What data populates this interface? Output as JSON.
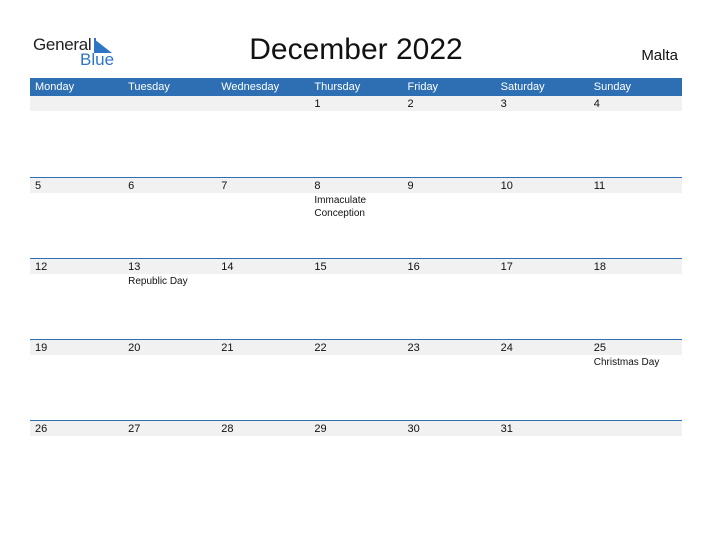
{
  "logo": {
    "text_general": "General",
    "text_blue": "Blue",
    "brand_color": "#2e75c8"
  },
  "title": "December 2022",
  "country": "Malta",
  "header_color": "#2e6fb4",
  "weekdays": [
    "Monday",
    "Tuesday",
    "Wednesday",
    "Thursday",
    "Friday",
    "Saturday",
    "Sunday"
  ],
  "weeks": [
    {
      "days": [
        {
          "num": "",
          "holiday": ""
        },
        {
          "num": "",
          "holiday": ""
        },
        {
          "num": "",
          "holiday": ""
        },
        {
          "num": "1",
          "holiday": ""
        },
        {
          "num": "2",
          "holiday": ""
        },
        {
          "num": "3",
          "holiday": ""
        },
        {
          "num": "4",
          "holiday": ""
        }
      ]
    },
    {
      "days": [
        {
          "num": "5",
          "holiday": ""
        },
        {
          "num": "6",
          "holiday": ""
        },
        {
          "num": "7",
          "holiday": ""
        },
        {
          "num": "8",
          "holiday": "Immaculate Conception"
        },
        {
          "num": "9",
          "holiday": ""
        },
        {
          "num": "10",
          "holiday": ""
        },
        {
          "num": "11",
          "holiday": ""
        }
      ]
    },
    {
      "days": [
        {
          "num": "12",
          "holiday": ""
        },
        {
          "num": "13",
          "holiday": "Republic Day"
        },
        {
          "num": "14",
          "holiday": ""
        },
        {
          "num": "15",
          "holiday": ""
        },
        {
          "num": "16",
          "holiday": ""
        },
        {
          "num": "17",
          "holiday": ""
        },
        {
          "num": "18",
          "holiday": ""
        }
      ]
    },
    {
      "days": [
        {
          "num": "19",
          "holiday": ""
        },
        {
          "num": "20",
          "holiday": ""
        },
        {
          "num": "21",
          "holiday": ""
        },
        {
          "num": "22",
          "holiday": ""
        },
        {
          "num": "23",
          "holiday": ""
        },
        {
          "num": "24",
          "holiday": ""
        },
        {
          "num": "25",
          "holiday": "Christmas Day"
        }
      ]
    },
    {
      "days": [
        {
          "num": "26",
          "holiday": ""
        },
        {
          "num": "27",
          "holiday": ""
        },
        {
          "num": "28",
          "holiday": ""
        },
        {
          "num": "29",
          "holiday": ""
        },
        {
          "num": "30",
          "holiday": ""
        },
        {
          "num": "31",
          "holiday": ""
        },
        {
          "num": "",
          "holiday": ""
        }
      ]
    }
  ]
}
